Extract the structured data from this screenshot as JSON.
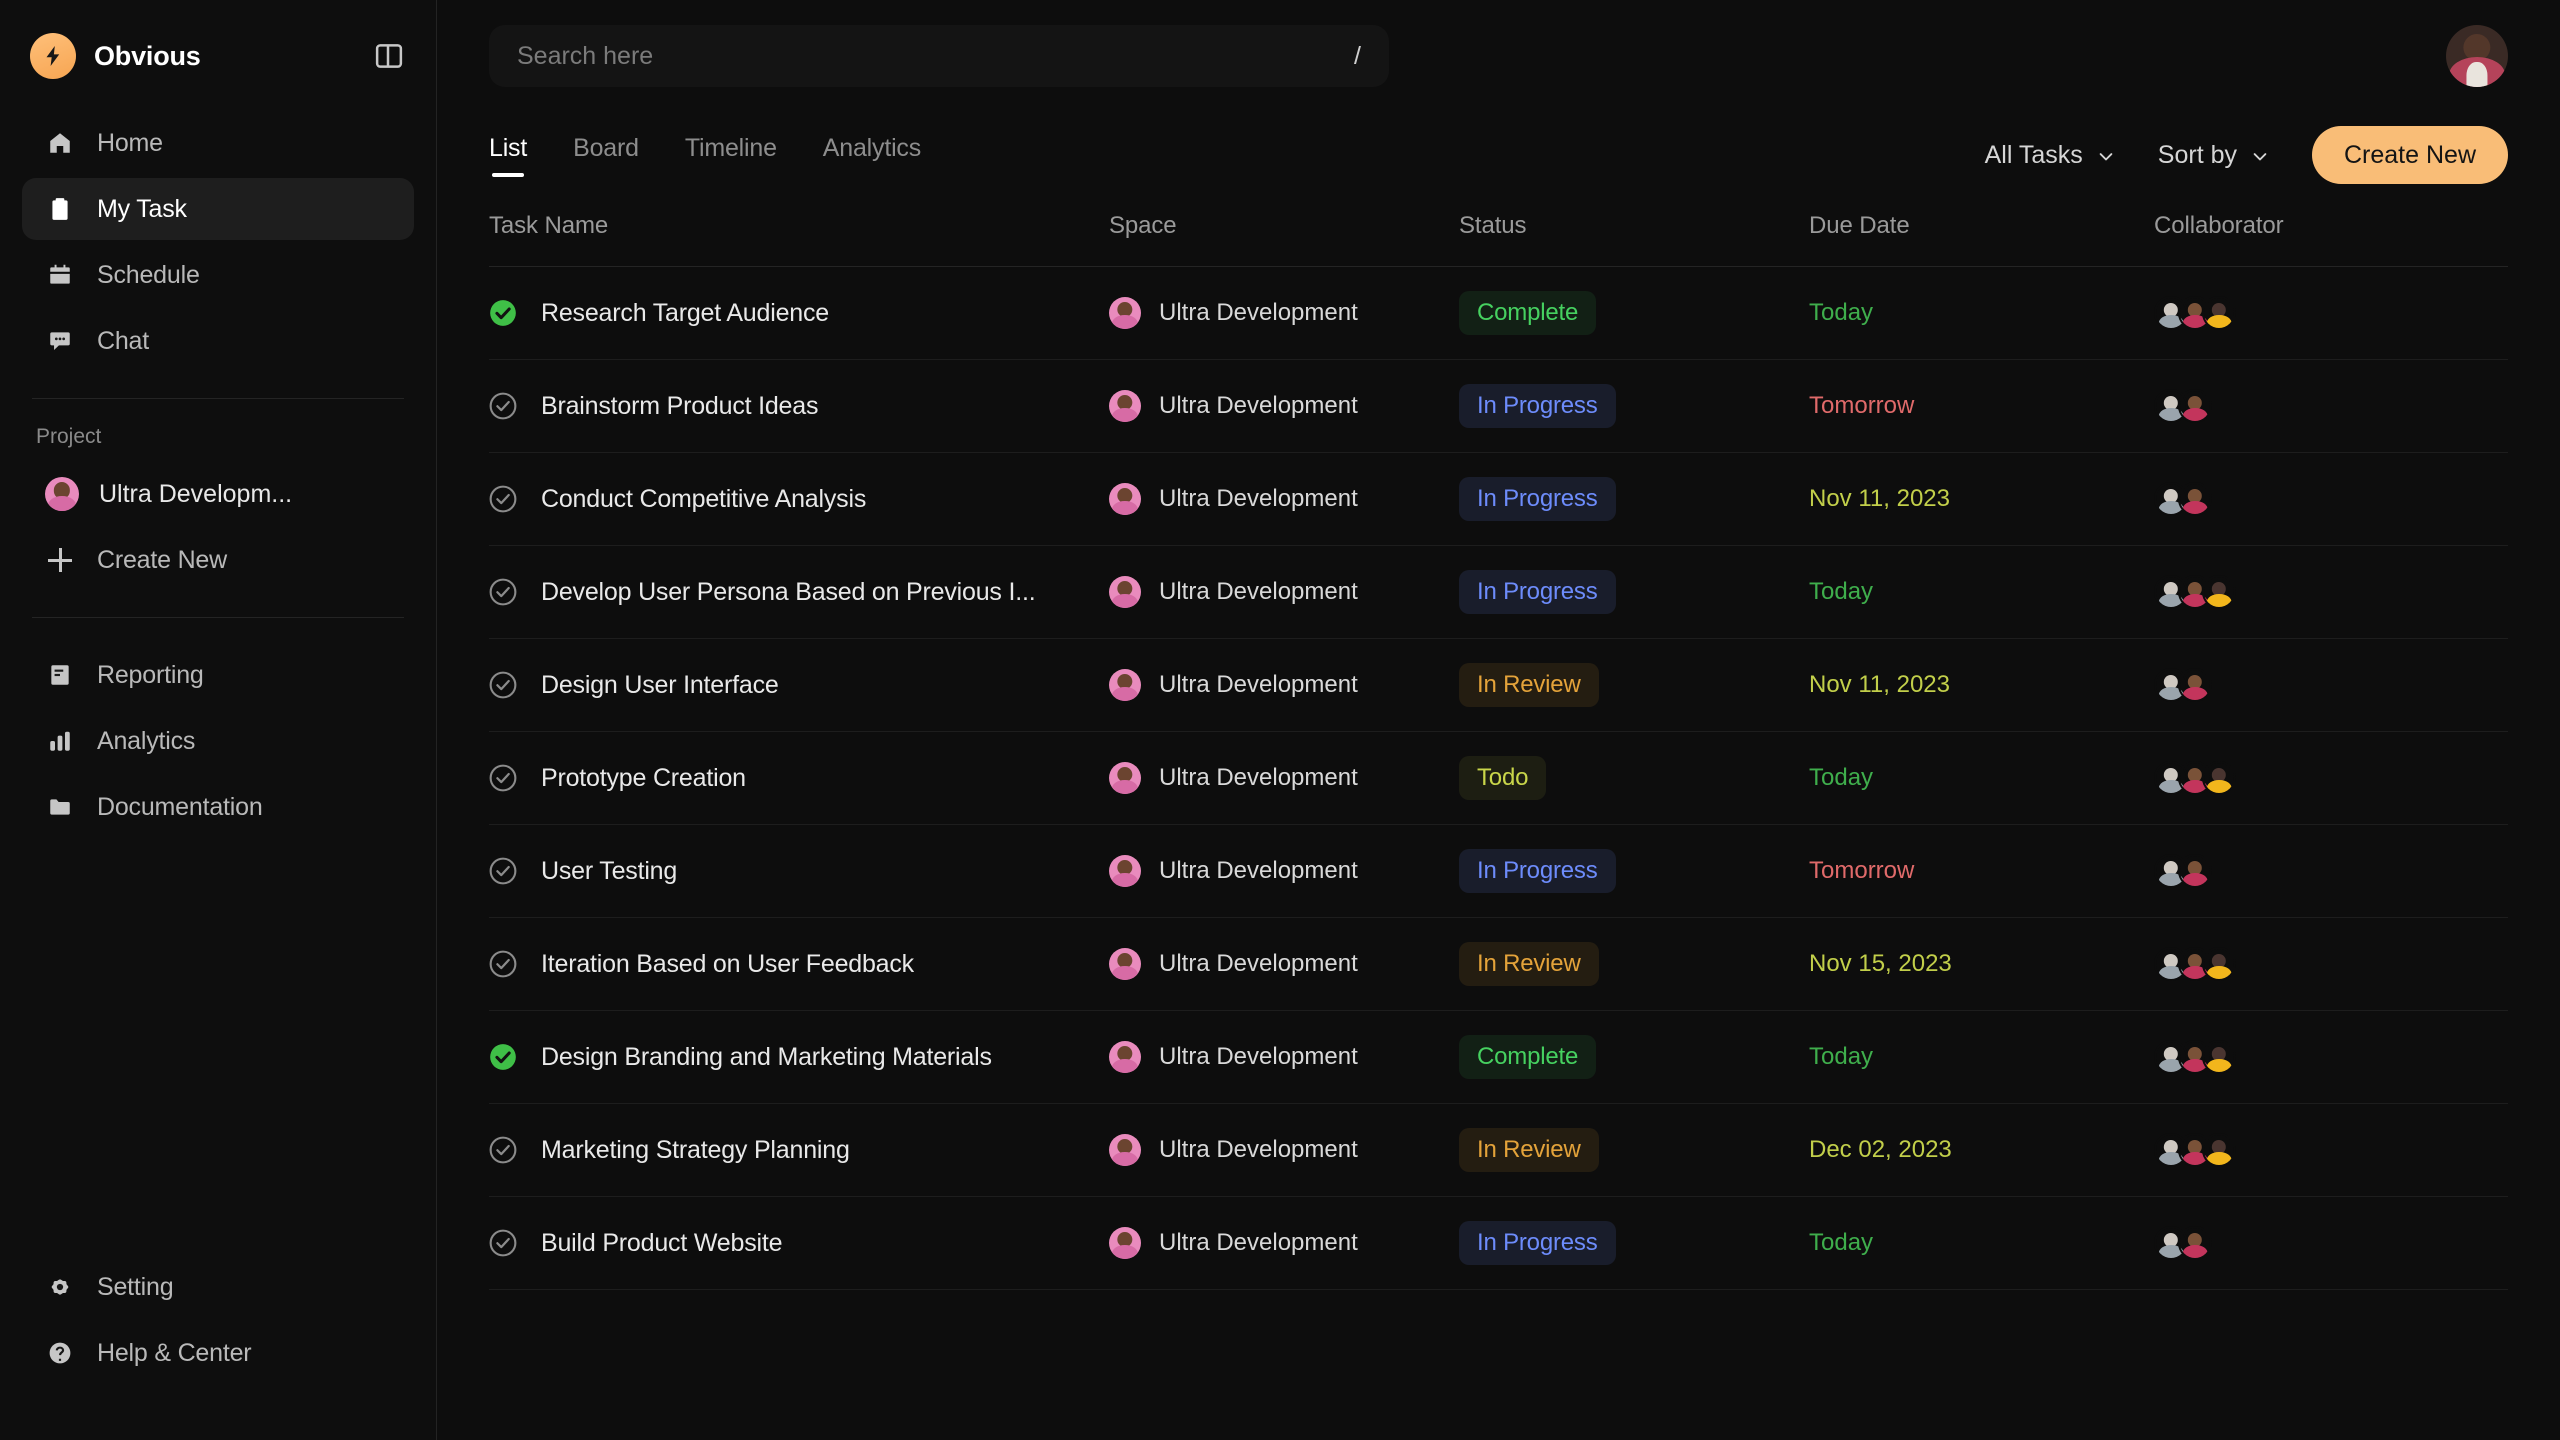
{
  "brand": {
    "name": "Obvious",
    "logo_icon": "lightning-bolt-icon",
    "collapse_icon": "panel-toggle-icon"
  },
  "sidebar": {
    "nav": [
      {
        "label": "Home",
        "icon": "home-icon",
        "active": false
      },
      {
        "label": "My Task",
        "icon": "clipboard-icon",
        "active": true
      },
      {
        "label": "Schedule",
        "icon": "calendar-icon",
        "active": false
      },
      {
        "label": "Chat",
        "icon": "chat-icon",
        "active": false
      }
    ],
    "project_section_title": "Project",
    "projects": [
      {
        "label": "Ultra Developm...",
        "icon": "project-avatar"
      }
    ],
    "project_create_label": "Create New",
    "tools": [
      {
        "label": "Reporting",
        "icon": "document-icon"
      },
      {
        "label": "Analytics",
        "icon": "bar-chart-icon"
      },
      {
        "label": "Documentation",
        "icon": "folder-icon"
      }
    ],
    "bottom": [
      {
        "label": "Setting",
        "icon": "gear-icon"
      },
      {
        "label": "Help & Center",
        "icon": "question-circle-icon"
      }
    ]
  },
  "search": {
    "placeholder": "Search here",
    "shortcut": "/"
  },
  "header": {
    "avatar_icon": "user-avatar"
  },
  "tabs": [
    {
      "label": "List",
      "active": true
    },
    {
      "label": "Board",
      "active": false
    },
    {
      "label": "Timeline",
      "active": false
    },
    {
      "label": "Analytics",
      "active": false
    }
  ],
  "toolbar": {
    "filter_label": "All Tasks",
    "sort_label": "Sort by",
    "create_label": "Create New",
    "accent_color": "#f9bd77"
  },
  "table": {
    "columns": [
      "Task Name",
      "Space",
      "Status",
      "Due Date",
      "Collaborator"
    ],
    "rows": [
      {
        "task": "Research Target Audience",
        "done": true,
        "space": "Ultra Development",
        "status": "Complete",
        "status_key": "complete",
        "due": "Today",
        "due_key": "today",
        "collaborators": 3
      },
      {
        "task": "Brainstorm Product Ideas",
        "done": false,
        "space": "Ultra Development",
        "status": "In Progress",
        "status_key": "inprogress",
        "due": "Tomorrow",
        "due_key": "tomorrow",
        "collaborators": 2
      },
      {
        "task": "Conduct Competitive Analysis",
        "done": false,
        "space": "Ultra Development",
        "status": "In Progress",
        "status_key": "inprogress",
        "due": "Nov 11, 2023",
        "due_key": "date",
        "collaborators": 2
      },
      {
        "task": "Develop User Persona Based on Previous I...",
        "done": false,
        "space": "Ultra Development",
        "status": "In Progress",
        "status_key": "inprogress",
        "due": "Today",
        "due_key": "today",
        "collaborators": 3
      },
      {
        "task": "Design User Interface",
        "done": false,
        "space": "Ultra Development",
        "status": "In Review",
        "status_key": "inreview",
        "due": "Nov 11, 2023",
        "due_key": "date",
        "collaborators": 2
      },
      {
        "task": "Prototype Creation",
        "done": false,
        "space": "Ultra Development",
        "status": "Todo",
        "status_key": "todo",
        "due": "Today",
        "due_key": "today",
        "collaborators": 3
      },
      {
        "task": "User Testing",
        "done": false,
        "space": "Ultra Development",
        "status": "In Progress",
        "status_key": "inprogress",
        "due": "Tomorrow",
        "due_key": "tomorrow",
        "collaborators": 2
      },
      {
        "task": "Iteration Based on User Feedback",
        "done": false,
        "space": "Ultra Development",
        "status": "In Review",
        "status_key": "inreview",
        "due": "Nov 15, 2023",
        "due_key": "date",
        "collaborators": 3
      },
      {
        "task": "Design Branding and Marketing Materials",
        "done": true,
        "space": "Ultra Development",
        "status": "Complete",
        "status_key": "complete",
        "due": "Today",
        "due_key": "today",
        "collaborators": 3
      },
      {
        "task": "Marketing Strategy Planning",
        "done": false,
        "space": "Ultra Development",
        "status": "In Review",
        "status_key": "inreview",
        "due": "Dec 02, 2023",
        "due_key": "date",
        "collaborators": 3
      },
      {
        "task": "Build Product Website",
        "done": false,
        "space": "Ultra Development",
        "status": "In Progress",
        "status_key": "inprogress",
        "due": "Today",
        "due_key": "today",
        "collaborators": 2
      }
    ]
  }
}
